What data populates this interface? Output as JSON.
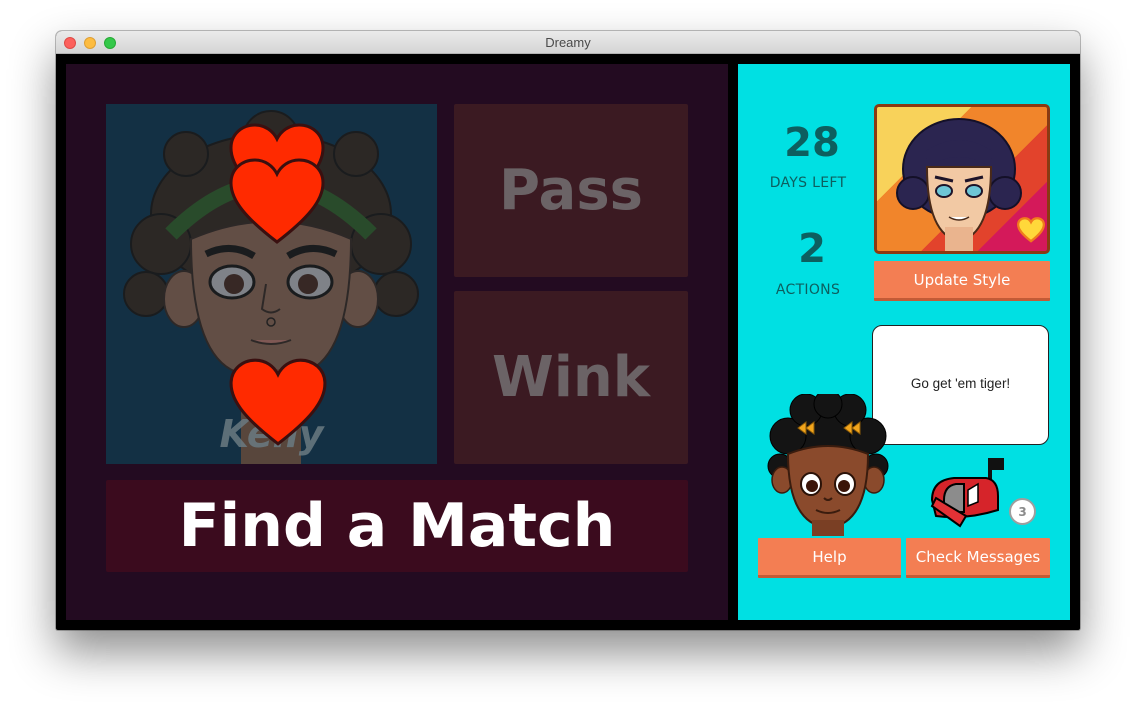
{
  "window": {
    "title": "Dreamy"
  },
  "profile": {
    "name": "Kelly"
  },
  "actions": {
    "pass_label": "Pass",
    "wink_label": "Wink",
    "find_match_label": "Find a Match"
  },
  "stats": {
    "days_left_value": "28",
    "days_left_label": "DAYS LEFT",
    "actions_value": "2",
    "actions_label": "ACTIONS"
  },
  "player": {
    "update_style_label": "Update Style"
  },
  "helper": {
    "speech": "Go get 'em tiger!",
    "help_label": "Help"
  },
  "messages": {
    "check_label": "Check Messages",
    "unread_count": "3"
  },
  "colors": {
    "left_bg": "#230b21",
    "right_bg": "#00e0e3",
    "accent": "#f37e53",
    "heart": "#ff2a00"
  },
  "icons": [
    "heart-icon",
    "mailbox-icon",
    "small-heart-icon"
  ]
}
